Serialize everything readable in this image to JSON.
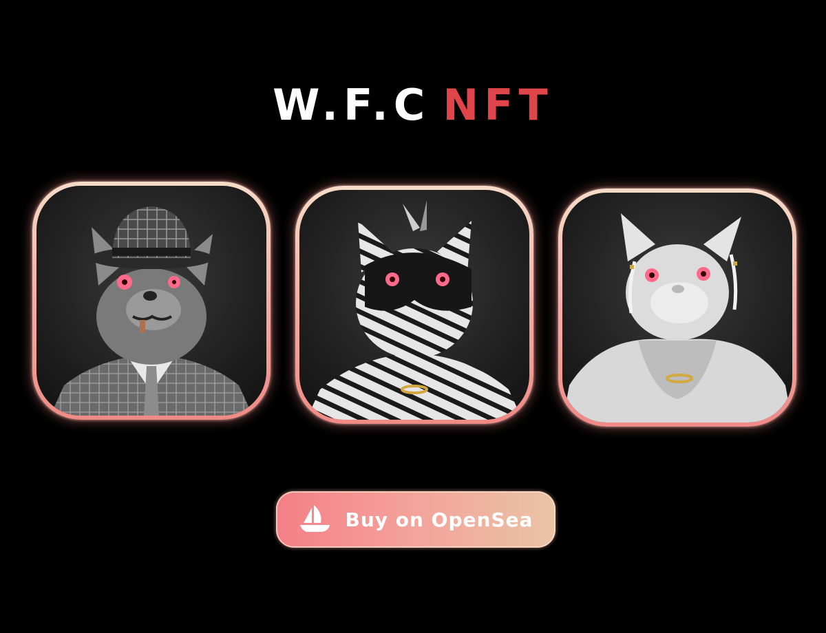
{
  "header": {
    "title_part1": "W.F.C",
    "title_part2": "NFT"
  },
  "colors": {
    "background": "#000000",
    "accent_red": "#e0454a",
    "card_border": "#f4a8a0",
    "eye_pink": "#ff6a8a"
  },
  "gallery": {
    "items": [
      {
        "icon": "wolf-bowler-hat-suit-avatar"
      },
      {
        "icon": "tiger-striped-masked-avatar"
      },
      {
        "icon": "white-wolf-fur-coat-avatar"
      }
    ]
  },
  "cta": {
    "label": "Buy on OpenSea",
    "icon": "opensea-ship-icon"
  }
}
